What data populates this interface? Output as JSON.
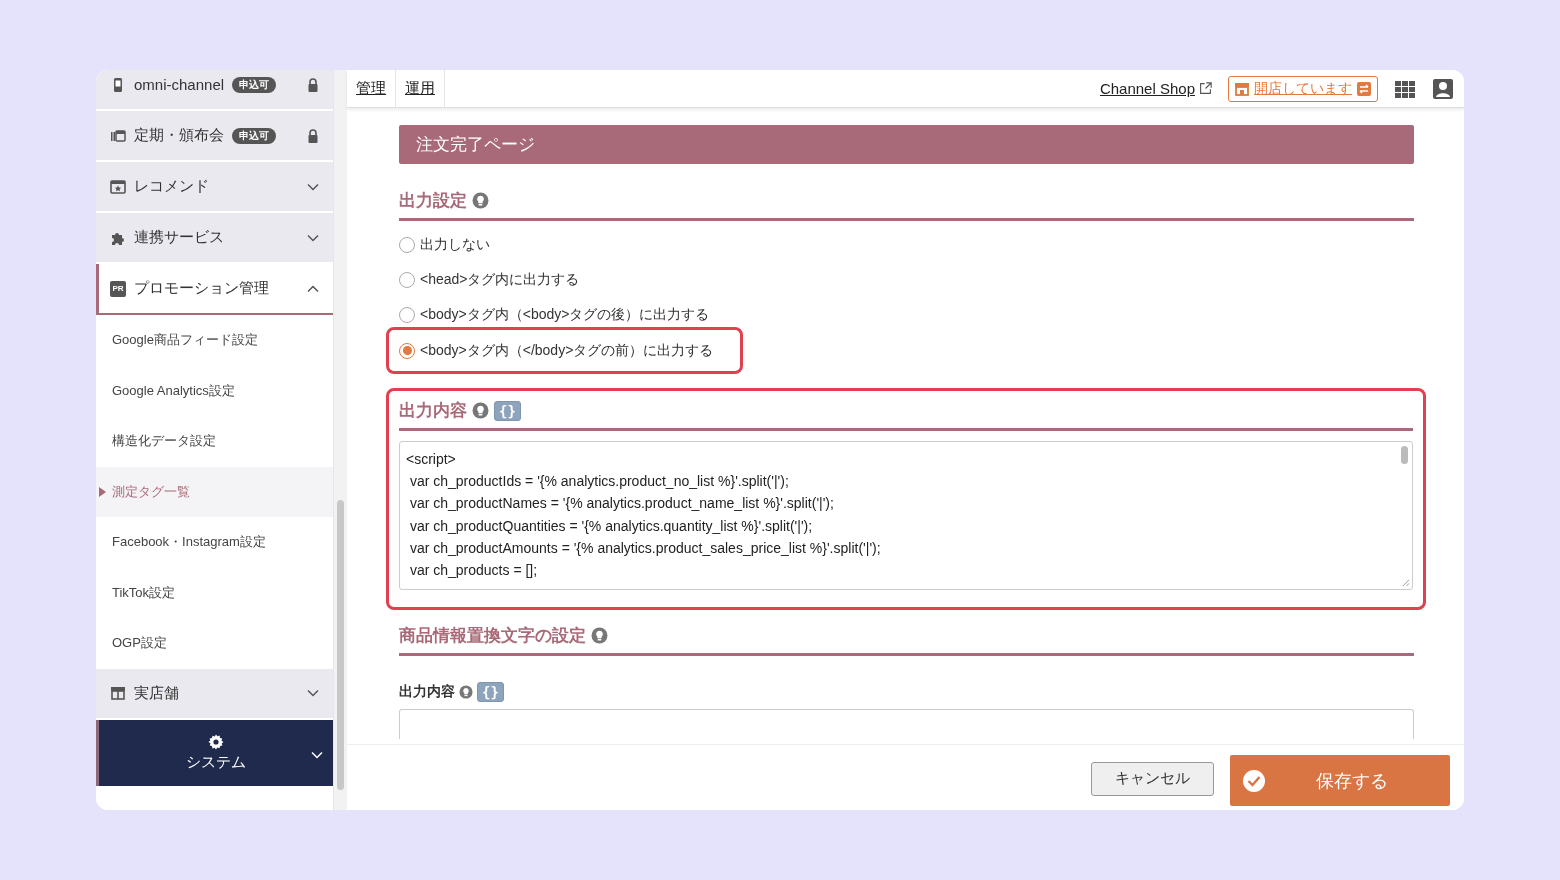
{
  "sidebar": {
    "items": [
      {
        "label": "omni-channel",
        "kind": "locked",
        "badge": "申込可"
      },
      {
        "label": "定期・頒布会",
        "kind": "locked",
        "badge": "申込可"
      },
      {
        "label": "レコメンド",
        "kind": "collapsible",
        "expanded": false
      },
      {
        "label": "連携サービス",
        "kind": "collapsible",
        "expanded": false
      },
      {
        "label": "プロモーション管理",
        "kind": "collapsible",
        "icon_text": "PR",
        "expanded": true,
        "children": [
          {
            "label": "Google商品フィード設定",
            "selected": false
          },
          {
            "label": "Google Analytics設定",
            "selected": false
          },
          {
            "label": "構造化データ設定",
            "selected": false
          },
          {
            "label": "測定タグ一覧",
            "selected": true
          },
          {
            "label": "Facebook・Instagram設定",
            "selected": false
          },
          {
            "label": "TikTok設定",
            "selected": false
          },
          {
            "label": "OGP設定",
            "selected": false
          }
        ]
      },
      {
        "label": "実店舗",
        "kind": "collapsible",
        "expanded": false
      },
      {
        "label": "システム",
        "kind": "system",
        "expanded": false
      }
    ]
  },
  "top_bar": {
    "tabs": [
      {
        "label": "管理"
      },
      {
        "label": "運用"
      }
    ],
    "shop_link": "Channel Shop",
    "store_status": "開店しています"
  },
  "page_title": "注文完了ページ",
  "output_settings": {
    "title": "出力設定",
    "options": [
      {
        "label": "出力しない",
        "selected": false,
        "highlighted": false
      },
      {
        "label": "<head>タグ内に出力する",
        "selected": false,
        "highlighted": false
      },
      {
        "label": "<body>タグ内（<body>タグの後）に出力する",
        "selected": false,
        "highlighted": false
      },
      {
        "label": "<body>タグ内（</body>タグの前）に出力する",
        "selected": true,
        "highlighted": true
      }
    ]
  },
  "output_content": {
    "title": "出力内容",
    "tag_button": "{}",
    "highlighted": true,
    "code_lines": [
      "<script>",
      " var ch_productIds = '{% analytics.product_no_list %}'.split('|');",
      " var ch_productNames = '{% analytics.product_name_list %}'.split('|');",
      " var ch_productQuantities = '{% analytics.quantity_list %}'.split('|');",
      " var ch_productAmounts = '{% analytics.product_sales_price_list %}'.split('|');",
      " var ch_products = [];"
    ]
  },
  "replacement": {
    "title": "商品情報置換文字の設定",
    "field_label": "出力内容",
    "tag_button": "{}"
  },
  "footer": {
    "cancel": "キャンセル",
    "save": "保存する"
  }
}
